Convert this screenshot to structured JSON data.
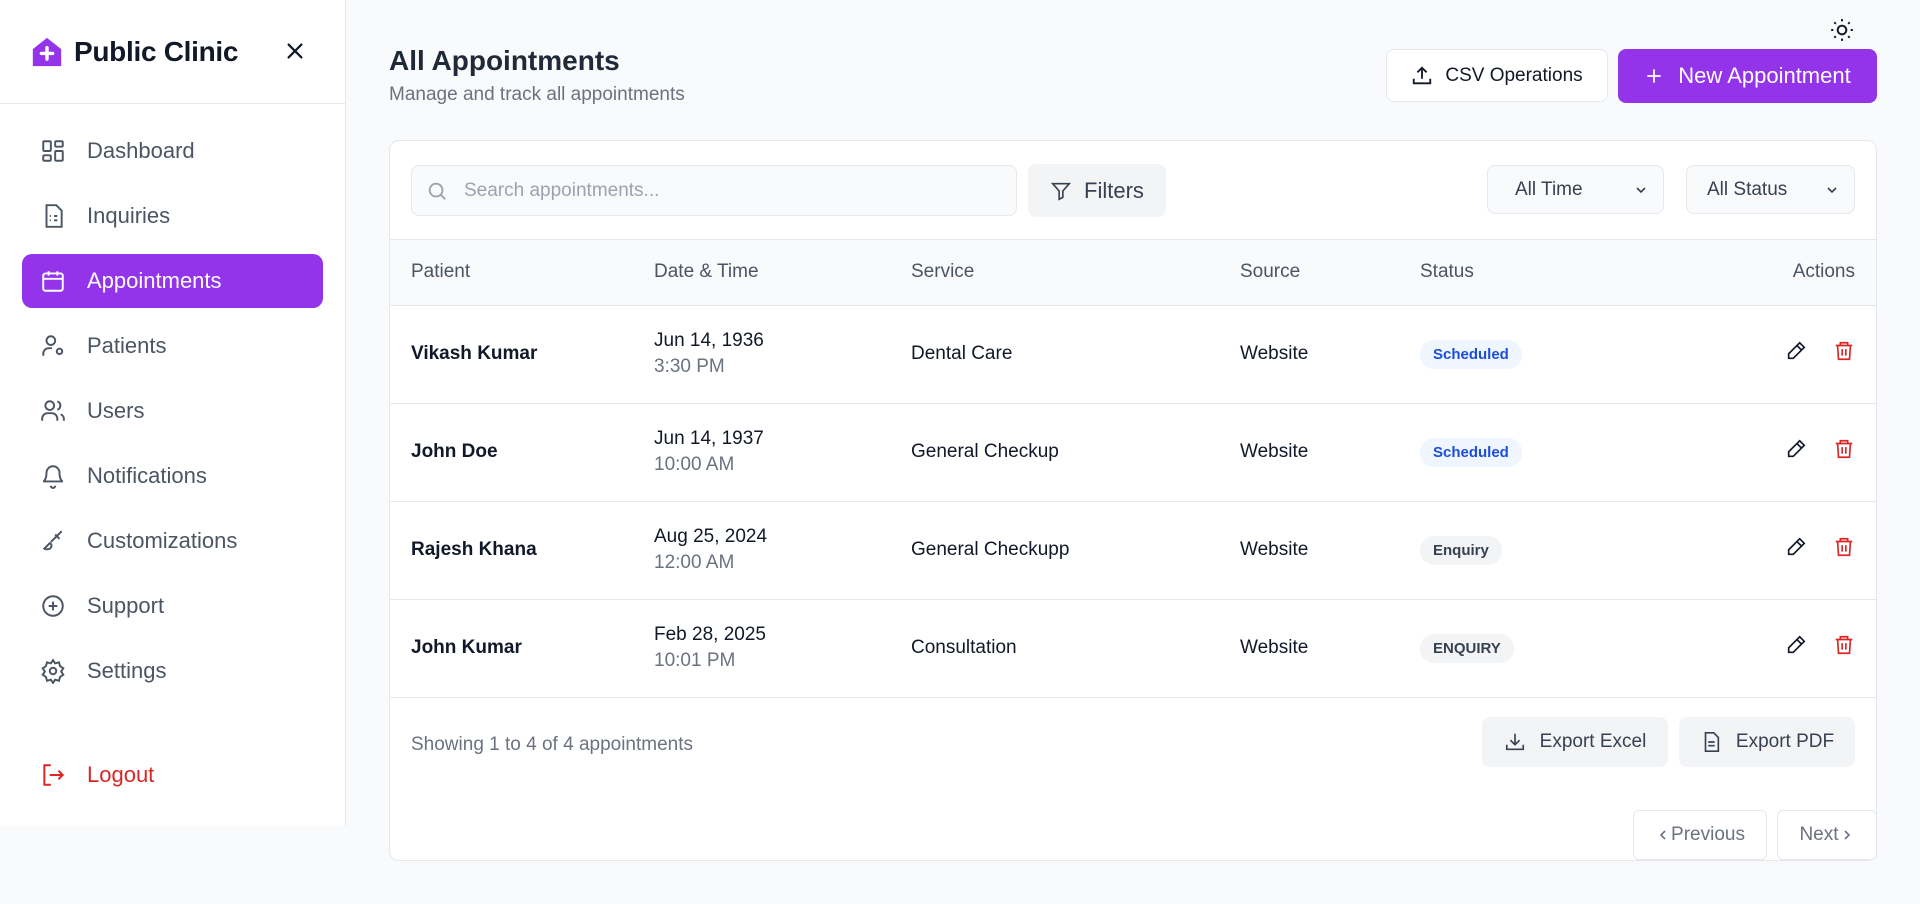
{
  "sidebar": {
    "brand": "Public Clinic",
    "items": [
      {
        "label": "Dashboard",
        "icon": "dashboard-icon"
      },
      {
        "label": "Inquiries",
        "icon": "document-icon"
      },
      {
        "label": "Appointments",
        "icon": "calendar-icon",
        "active": true
      },
      {
        "label": "Patients",
        "icon": "user-gear-icon"
      },
      {
        "label": "Users",
        "icon": "users-icon"
      },
      {
        "label": "Notifications",
        "icon": "bell-icon"
      },
      {
        "label": "Customizations",
        "icon": "brush-icon"
      },
      {
        "label": "Support",
        "icon": "plus-circle-icon"
      },
      {
        "label": "Settings",
        "icon": "gear-icon"
      }
    ],
    "logout": "Logout"
  },
  "header": {
    "title": "All Appointments",
    "subtitle": "Manage and track all appointments",
    "csv_label": "CSV Operations",
    "new_label": "New Appointment"
  },
  "toolbar": {
    "search_placeholder": "Search appointments...",
    "filters_label": "Filters",
    "time_filter": "All Time",
    "status_filter": "All Status"
  },
  "table": {
    "columns": [
      "Patient",
      "Date & Time",
      "Service",
      "Source",
      "Status",
      "Actions"
    ],
    "rows": [
      {
        "patient": "Vikash Kumar",
        "date": "Jun 14, 1936",
        "time": "3:30 PM",
        "service": "Dental Care",
        "source": "Website",
        "status": "Scheduled"
      },
      {
        "patient": "John Doe",
        "date": "Jun 14, 1937",
        "time": "10:00 AM",
        "service": "General Checkup",
        "source": "Website",
        "status": "Scheduled"
      },
      {
        "patient": "Rajesh Khana",
        "date": "Aug 25, 2024",
        "time": "12:00 AM",
        "service": "General Checkupp",
        "source": "Website",
        "status": "Enquiry"
      },
      {
        "patient": "John Kumar",
        "date": "Feb 28, 2025",
        "time": "10:01 PM",
        "service": "Consultation",
        "source": "Website",
        "status": "ENQUIRY"
      }
    ]
  },
  "footer": {
    "showing": "Showing 1 to 4 of 4 appointments",
    "export_excel": "Export Excel",
    "export_pdf": "Export PDF",
    "previous": "Previous",
    "next": "Next"
  },
  "colors": {
    "accent": "#9333ea",
    "danger": "#dc2626",
    "scheduled_bg": "#eff6ff",
    "scheduled_text": "#1d4ed8"
  }
}
